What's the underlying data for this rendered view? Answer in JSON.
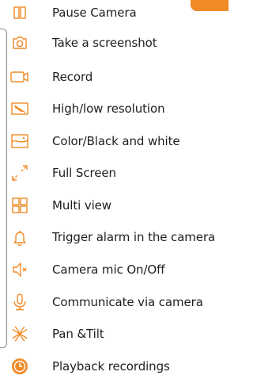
{
  "accent_color": "#f08a26",
  "legend": {
    "items": [
      {
        "icon": "pause-icon",
        "label": "Pause Camera"
      },
      {
        "icon": "camera-icon",
        "label": "Take a screenshot"
      },
      {
        "icon": "video-record-icon",
        "label": "Record"
      },
      {
        "icon": "resolution-icon",
        "label": "High/low resolution"
      },
      {
        "icon": "color-mode-icon",
        "label": "Color/Black and white"
      },
      {
        "icon": "fullscreen-icon",
        "label": "Full Screen"
      },
      {
        "icon": "grid-icon",
        "label": "Multi view"
      },
      {
        "icon": "bell-icon",
        "label": "Trigger alarm in the camera"
      },
      {
        "icon": "speaker-mute-icon",
        "label": "Camera mic On/Off"
      },
      {
        "icon": "microphone-icon",
        "label": "Communicate via camera"
      },
      {
        "icon": "pan-tilt-icon",
        "label": "Pan &Tilt"
      },
      {
        "icon": "playback-icon",
        "label": "Playback recordings"
      }
    ]
  }
}
